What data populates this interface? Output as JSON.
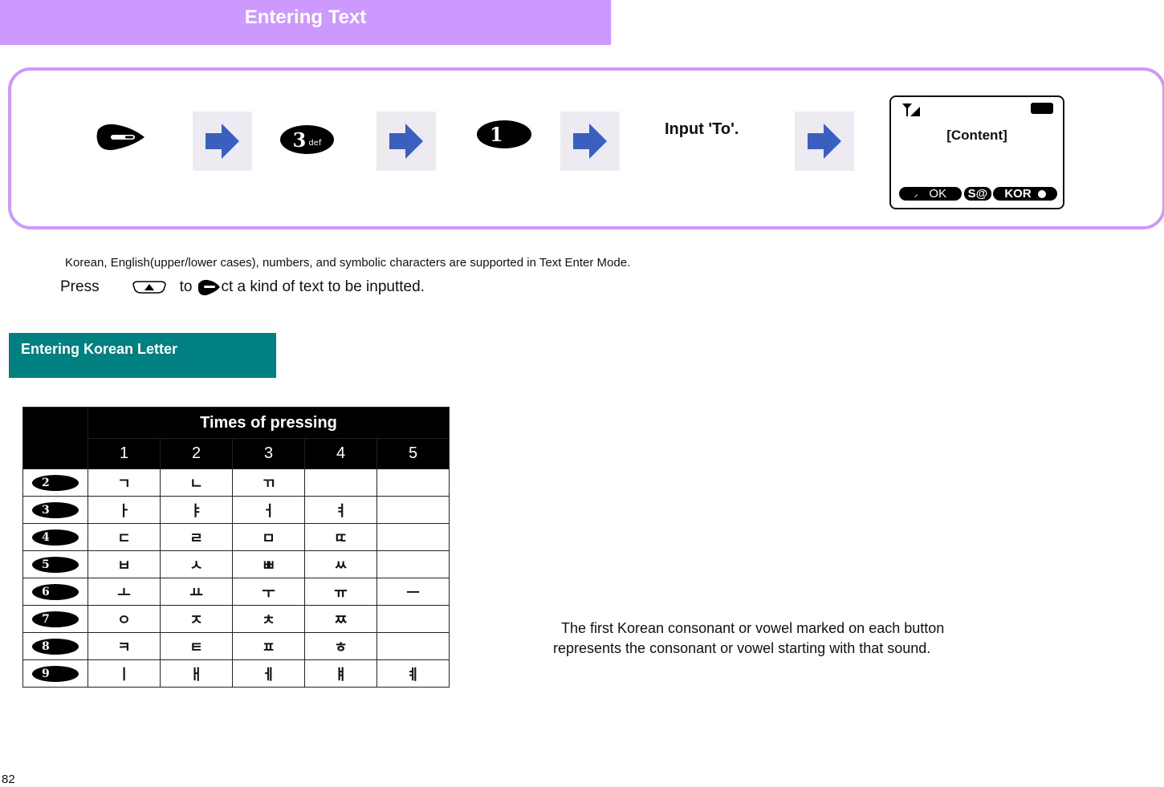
{
  "header": {
    "title": "Entering Text",
    "bar_color": "#cc99ff"
  },
  "steps": {
    "items": [
      {
        "type": "key",
        "icon": "menu-soft-key-icon"
      },
      {
        "type": "arrow",
        "icon": "right-arrow-icon"
      },
      {
        "type": "key",
        "icon": "key-3-icon",
        "label": "3",
        "sub": "def"
      },
      {
        "type": "arrow",
        "icon": "right-arrow-icon"
      },
      {
        "type": "key",
        "icon": "key-1-icon",
        "label": "1"
      },
      {
        "type": "arrow",
        "icon": "right-arrow-icon"
      },
      {
        "type": "text",
        "label": "Input 'To'."
      },
      {
        "type": "arrow",
        "icon": "right-arrow-icon"
      }
    ],
    "instruction": "Input 'To'.",
    "key3_label": "3",
    "key3_sub": "def",
    "key1_label": "1"
  },
  "phone_screen": {
    "content": "[Content]",
    "softkeys": {
      "left": "OK",
      "middle": "S@",
      "right": "KOR"
    }
  },
  "notes": {
    "supported": "Korean, English(upper/lower cases), numbers, and symbolic characters are supported in Text Enter Mode.",
    "press_prefix": "Press",
    "press_middle": "to",
    "press_suffix": "ct a kind of text to be inputted."
  },
  "section": {
    "title": "Entering Korean Letter",
    "bar_color": "#008080"
  },
  "table": {
    "title": "Times of pressing",
    "columns": [
      "1",
      "2",
      "3",
      "4",
      "5"
    ],
    "rows": [
      {
        "key": "2",
        "chars": [
          "ㄱ",
          "ㄴ",
          "ㄲ",
          "",
          ""
        ]
      },
      {
        "key": "3",
        "chars": [
          "ㅏ",
          "ㅑ",
          "ㅓ",
          "ㅕ",
          ""
        ]
      },
      {
        "key": "4",
        "chars": [
          "ㄷ",
          "ㄹ",
          "ㅁ",
          "ㄸ",
          ""
        ]
      },
      {
        "key": "5",
        "chars": [
          "ㅂ",
          "ㅅ",
          "ㅃ",
          "ㅆ",
          ""
        ]
      },
      {
        "key": "6",
        "chars": [
          "ㅗ",
          "ㅛ",
          "ㅜ",
          "ㅠ",
          "ㅡ"
        ]
      },
      {
        "key": "7",
        "chars": [
          "ㅇ",
          "ㅈ",
          "ㅊ",
          "ㅉ",
          ""
        ]
      },
      {
        "key": "8",
        "chars": [
          "ㅋ",
          "ㅌ",
          "ㅍ",
          "ㅎ",
          ""
        ]
      },
      {
        "key": "9",
        "chars": [
          "ㅣ",
          "ㅐ",
          "ㅔ",
          "ㅒ",
          "ㅖ"
        ]
      }
    ]
  },
  "description": {
    "line1": "The first Korean consonant or vowel marked on each button",
    "line2": "represents the consonant or vowel starting with that sound."
  },
  "page_number": "82"
}
